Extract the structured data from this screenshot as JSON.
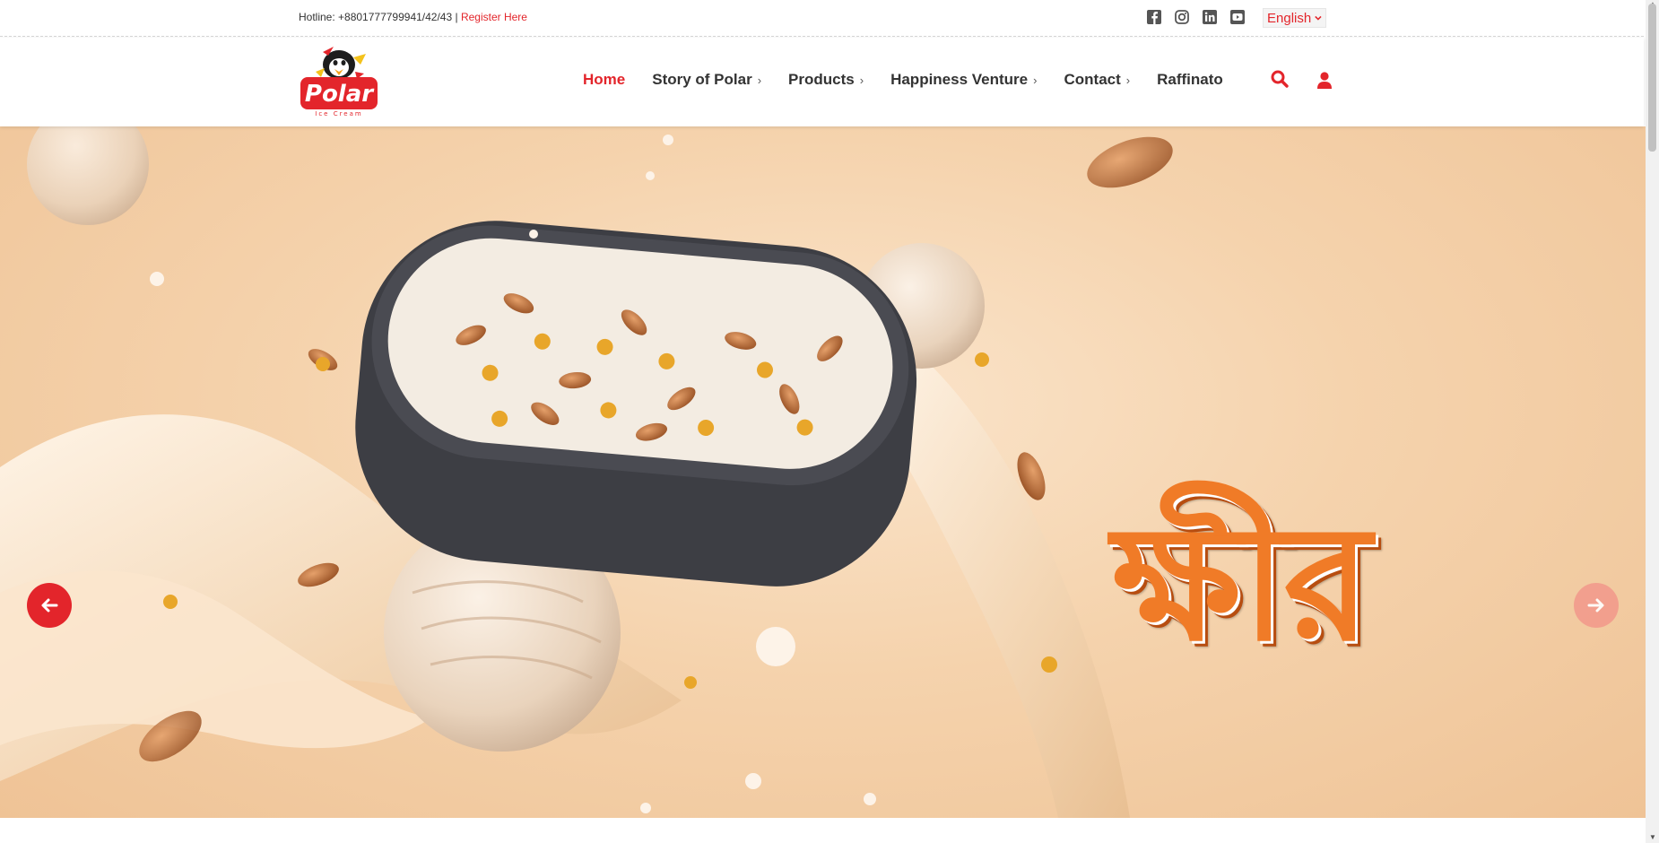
{
  "topbar": {
    "hotline": "Hotline: +8801777799941/42/43 |",
    "register_label": "Register Here",
    "social": [
      "facebook-icon",
      "instagram-icon",
      "linkedin-icon",
      "youtube-icon"
    ],
    "language": "English"
  },
  "brand": {
    "name": "Polar",
    "tagline": "Ice Cream"
  },
  "nav": {
    "items": [
      {
        "label": "Home",
        "active": true,
        "has_submenu": false
      },
      {
        "label": "Story of Polar",
        "active": false,
        "has_submenu": true
      },
      {
        "label": "Products",
        "active": false,
        "has_submenu": true
      },
      {
        "label": "Happiness Venture",
        "active": false,
        "has_submenu": true
      },
      {
        "label": "Contact",
        "active": false,
        "has_submenu": true
      },
      {
        "label": "Raffinato",
        "active": false,
        "has_submenu": false
      }
    ],
    "chevron": "›",
    "icons": [
      "search-icon",
      "user-icon"
    ]
  },
  "hero": {
    "title": "ক্ষীর",
    "prev_arrow": "🡐",
    "next_arrow": "🡒"
  },
  "colors": {
    "accent": "#e3252b",
    "hero_text": "#f07b27",
    "hero_bg": "#f5d3ad"
  }
}
